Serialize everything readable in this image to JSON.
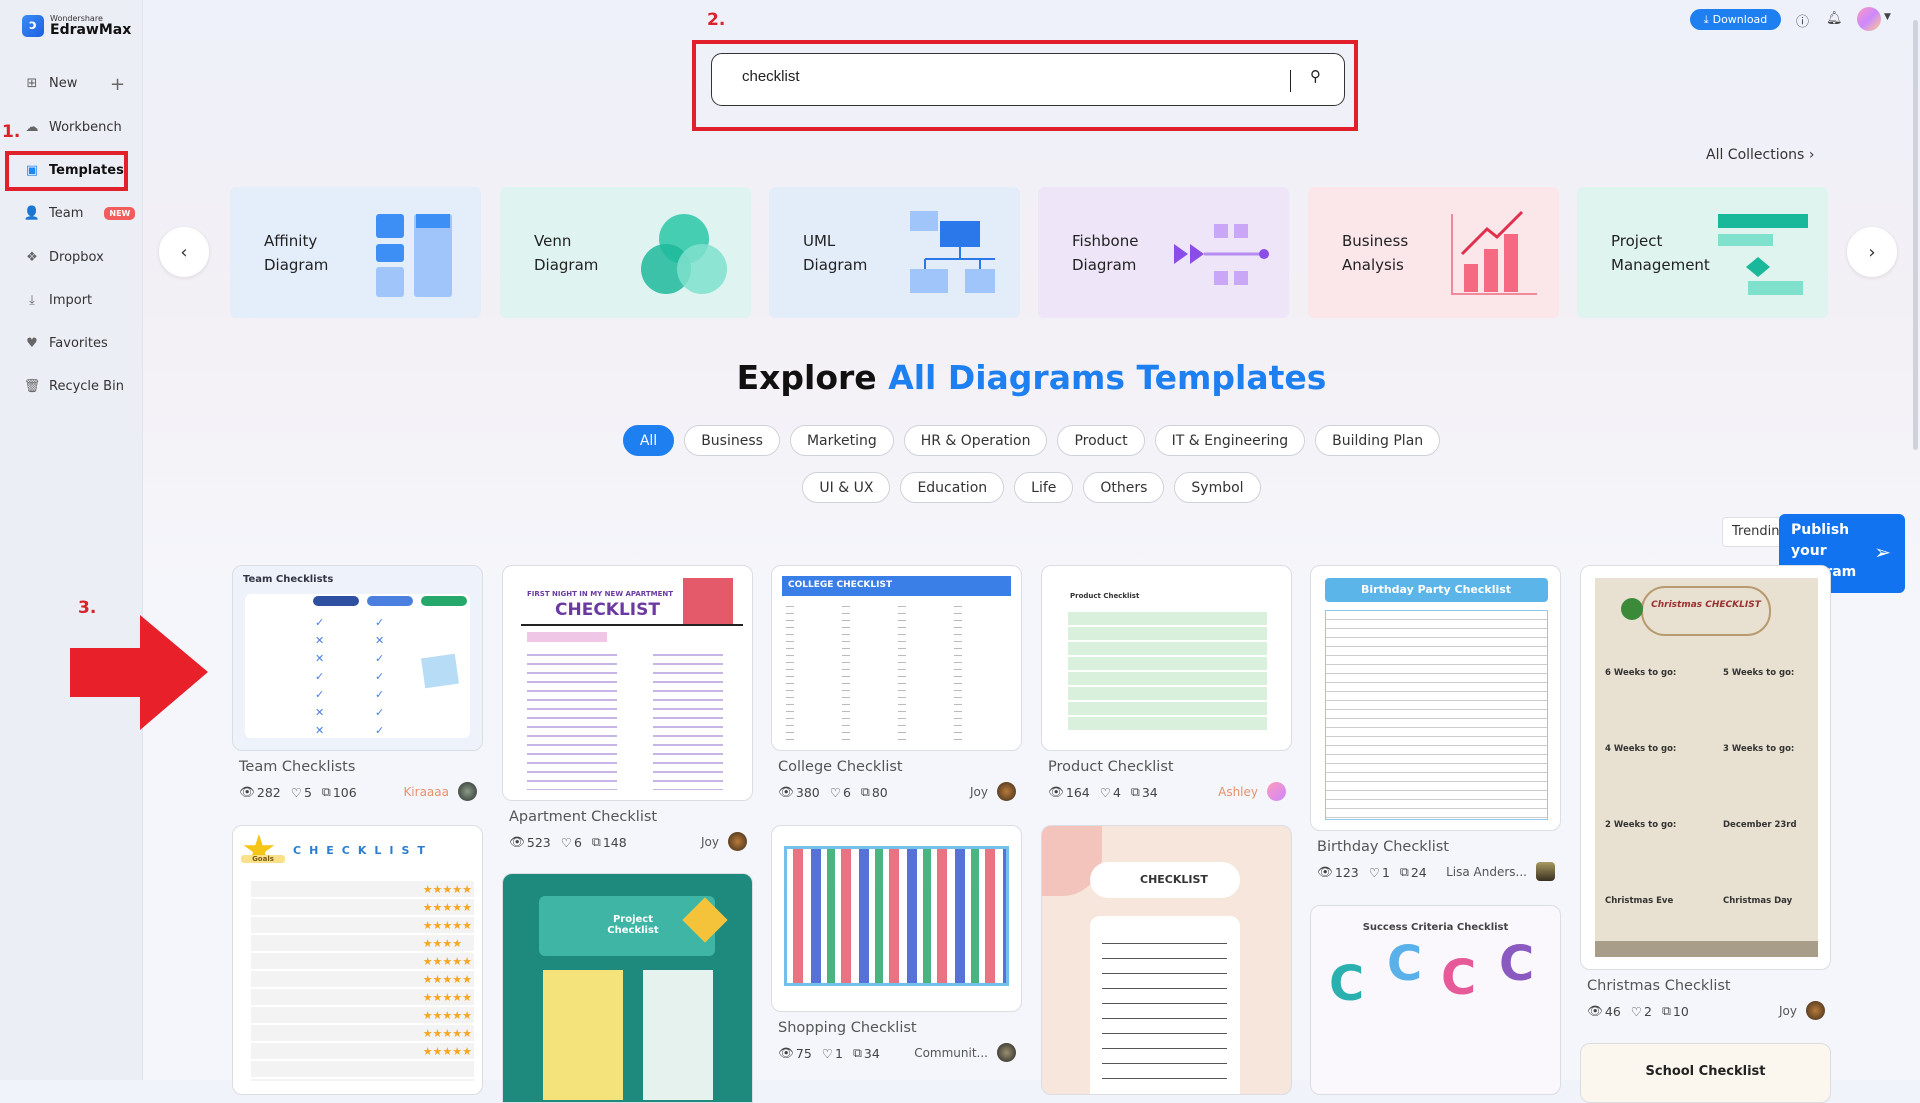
{
  "app": {
    "brand_small": "Wondershare",
    "brand_big": "EdrawMax"
  },
  "sidebar": {
    "items": [
      {
        "label": "New",
        "icon": "plus-square-icon"
      },
      {
        "label": "Workbench",
        "icon": "cloud-icon"
      },
      {
        "label": "Templates",
        "icon": "templates-icon",
        "active": true
      },
      {
        "label": "Team",
        "icon": "team-icon",
        "badge": "NEW"
      },
      {
        "label": "Dropbox",
        "icon": "dropbox-icon"
      },
      {
        "label": "Import",
        "icon": "import-icon"
      },
      {
        "label": "Favorites",
        "icon": "heart-icon"
      },
      {
        "label": "Recycle Bin",
        "icon": "trash-icon"
      }
    ]
  },
  "annotations": {
    "step1": "1.",
    "step2": "2.",
    "step3": "3.",
    "highlight_color": "#e0202a"
  },
  "topbar": {
    "download": "Download"
  },
  "search": {
    "value": "checklist"
  },
  "collections": {
    "all_label": "All Collections"
  },
  "categories": [
    {
      "line1": "Affinity",
      "line2": "Diagram",
      "bg": "#e4eefb"
    },
    {
      "line1": "Venn",
      "line2": "Diagram",
      "bg": "#dff4f1"
    },
    {
      "line1": "UML",
      "line2": "Diagram",
      "bg": "#e3edfa"
    },
    {
      "line1": "Fishbone",
      "line2": "Diagram",
      "bg": "#eee6f8"
    },
    {
      "line1": "Business",
      "line2": "Analysis",
      "bg": "#fbe6ea"
    },
    {
      "line1": "Project",
      "line2": "Management",
      "bg": "#dff4ef"
    }
  ],
  "heading": {
    "plain": "Explore",
    "accent": "All Diagrams Templates"
  },
  "filters": {
    "row1": [
      "All",
      "Business",
      "Marketing",
      "HR & Operation",
      "Product",
      "IT & Engineering",
      "Building Plan"
    ],
    "row2": [
      "UI & UX",
      "Education",
      "Life",
      "Others",
      "Symbol"
    ],
    "active": "All"
  },
  "sort": {
    "value": "Trending"
  },
  "publish": {
    "l1": "Publish",
    "l2": "your",
    "l3": "diagram"
  },
  "cards": {
    "team": {
      "title": "Team Checklists",
      "views": "282",
      "likes": "5",
      "copies": "106",
      "author": "Kiraaaa",
      "thumb": "Team Checklists"
    },
    "apartment": {
      "title": "Apartment Checklist",
      "views": "523",
      "likes": "6",
      "copies": "148",
      "author": "Joy",
      "thumb": "CHECKLIST",
      "thumb_sub": "FIRST NIGHT IN MY NEW APARTMENT"
    },
    "college": {
      "title": "College Checklist",
      "views": "380",
      "likes": "6",
      "copies": "80",
      "author": "Joy",
      "thumb": "COLLEGE CHECKLIST"
    },
    "product": {
      "title": "Product Checklist",
      "views": "164",
      "likes": "4",
      "copies": "34",
      "author": "Ashley",
      "thumb": "Product Checklist"
    },
    "birthday": {
      "title": "Birthday Checklist",
      "views": "123",
      "likes": "1",
      "copies": "24",
      "author": "Lisa Anders...",
      "thumb": "Birthday Party Checklist"
    },
    "christmas": {
      "title": "Christmas Checklist",
      "views": "46",
      "likes": "2",
      "copies": "10",
      "author": "Joy",
      "thumb": "Christmas CHECKLIST",
      "sections": [
        "6 Weeks to go:",
        "5 Weeks to go:",
        "4 Weeks to go:",
        "3 Weeks to go:",
        "2 Weeks to go:",
        "December 23rd",
        "Christmas Eve",
        "Christmas Day"
      ]
    },
    "goals": {
      "thumb": "CHECKLIST",
      "star": "Goals"
    },
    "project": {
      "thumb": "Project Checklist"
    },
    "shopping": {
      "title": "Shopping Checklist",
      "views": "75",
      "likes": "1",
      "copies": "34",
      "author": "Communit..."
    },
    "plain": {
      "thumb": "CHECKLIST"
    },
    "success": {
      "thumb": "Success Criteria Checklist"
    },
    "school": {
      "thumb": "School Checklist"
    }
  }
}
